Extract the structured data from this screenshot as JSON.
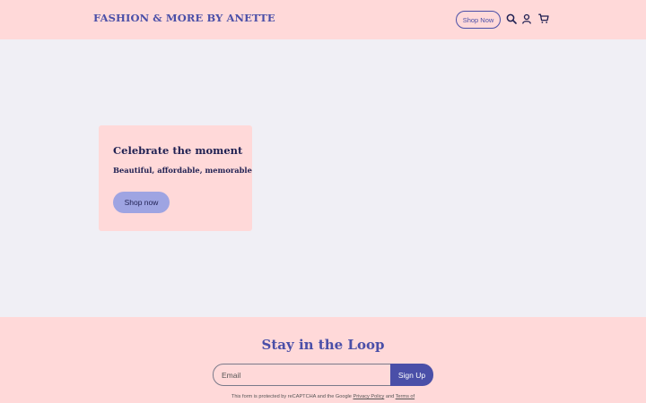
{
  "header": {
    "brand": "FASHION & MORE BY ANETTE",
    "shop_now_label": "Shop Now",
    "icons": [
      "search-icon",
      "account-icon",
      "cart-icon"
    ]
  },
  "hero": {
    "title": "Celebrate the moment",
    "subtitle": "Beautiful, affordable, memorable",
    "button_label": "Shop now"
  },
  "footer": {
    "title": "Stay in the Loop",
    "email_placeholder": "Email",
    "signup_label": "Sign Up",
    "legal_prefix": "This form is protected by reCAPTCHA and the Google ",
    "privacy_link": "Privacy Policy",
    "legal_and": " and ",
    "terms_link": "Terms of"
  },
  "colors": {
    "pink_bg": "#ffd9d9",
    "page_bg": "#f0eff5",
    "accent": "#4a4fa8",
    "button_light": "#9ea4e2",
    "text_dark": "#1f2052"
  }
}
